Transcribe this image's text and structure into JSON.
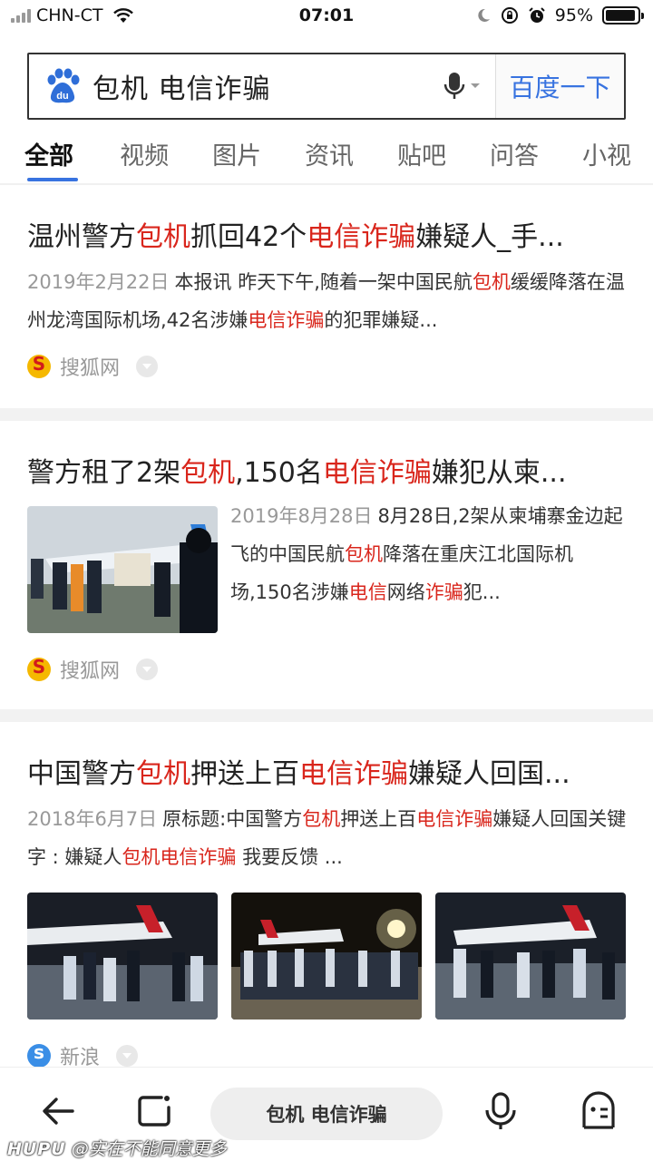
{
  "status_bar": {
    "carrier": "CHN-CT",
    "time": "07:01",
    "battery_percent": "95%",
    "battery_level": 0.95
  },
  "search": {
    "query": "包机 电信诈骗",
    "button_label": "百度一下"
  },
  "tabs": [
    "全部",
    "视频",
    "图片",
    "资讯",
    "贴吧",
    "问答",
    "小视"
  ],
  "results": [
    {
      "title_parts": [
        "温州警方",
        "包机",
        "抓回42个",
        "电信诈骗",
        "嫌疑人_手..."
      ],
      "date": "2019年2月22日",
      "snippet_parts": [
        "本报讯 昨天下午,随着一架中国民航",
        "包机",
        "缓缓降落在温州龙湾国际机场,42名涉嫌",
        "电信诈骗",
        "的犯罪嫌疑..."
      ],
      "source": "搜狐网"
    },
    {
      "title_parts": [
        "警方租了2架",
        "包机",
        ",150名",
        "电信诈骗",
        "嫌犯从柬..."
      ],
      "date": "2019年8月28日",
      "snippet_parts": [
        "8月28日,2架从柬埔寨金边起飞的中国民航",
        "包机",
        "降落在重庆江北国际机场,150名涉嫌",
        "电信",
        "网络",
        "诈骗",
        "犯..."
      ],
      "source": "搜狐网"
    },
    {
      "title_parts": [
        "中国警方",
        "包机",
        "押送上百",
        "电信诈骗",
        "嫌疑人回国..."
      ],
      "date": "2018年6月7日",
      "snippet_parts": [
        "原标题:中国警方",
        "包机",
        "押送上百",
        "电信诈骗",
        "嫌疑人回国关键字 : 嫌疑人",
        "包机电信诈骗",
        " 我要反馈 ..."
      ],
      "source": "新浪"
    }
  ],
  "bottom_bar": {
    "query": "包机 电信诈骗"
  },
  "watermark": {
    "brand": "HUPU",
    "text": "@实在不能同意更多"
  },
  "colors": {
    "highlight": "#d9261c",
    "accent": "#3873e0"
  }
}
